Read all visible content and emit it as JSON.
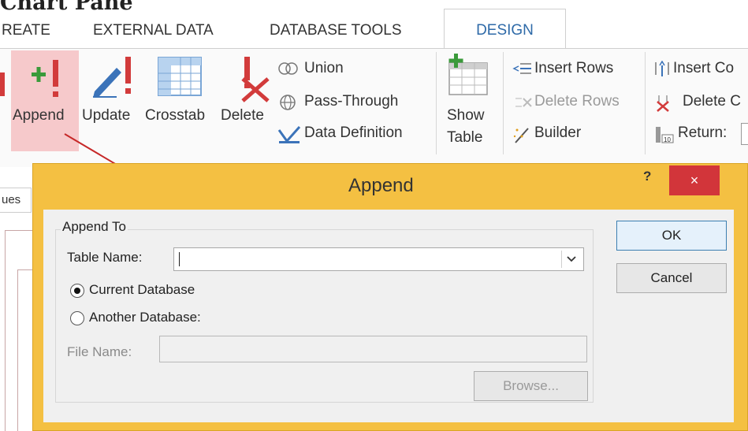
{
  "page": {
    "heading": "Chart Pane"
  },
  "tabs": [
    {
      "label": "REATE"
    },
    {
      "label": "EXTERNAL DATA"
    },
    {
      "label": "DATABASE TOOLS"
    },
    {
      "label": "DESIGN"
    }
  ],
  "ribbon": {
    "query_type": {
      "append": "Append",
      "update": "Update",
      "crosstab": "Crosstab",
      "delete": "Delete",
      "union": "Union",
      "pass_through": "Pass-Through",
      "data_definition": "Data Definition"
    },
    "show_table": {
      "line1": "Show",
      "line2": "Table"
    },
    "query_setup": {
      "insert_rows": "Insert Rows",
      "delete_rows": "Delete Rows",
      "builder": "Builder",
      "insert_columns": "Insert Co",
      "delete_columns": "Delete C",
      "return": "Return:"
    }
  },
  "left_panel": {
    "tab_fragment": "ues"
  },
  "dialog": {
    "title": "Append",
    "help": "?",
    "close": "×",
    "group_label": "Append To",
    "table_name_label": "Table Name:",
    "table_name_value": "",
    "current_db_label": "Current Database",
    "another_db_label": "Another Database:",
    "current_db_selected": true,
    "file_name_label": "File Name:",
    "file_name_value": "",
    "browse": "Browse...",
    "ok": "OK",
    "cancel": "Cancel"
  },
  "colors": {
    "accent_title": "#f4c042",
    "close_red": "#d2353a",
    "design_tab_text": "#2e6aa8",
    "append_highlight": "#f6c9cb",
    "arrow": "#c62828"
  }
}
